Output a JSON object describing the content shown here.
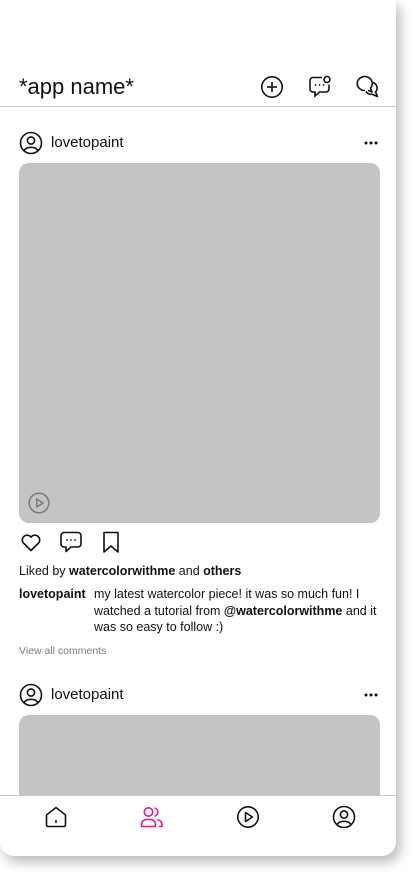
{
  "header": {
    "app_name": "*app name*",
    "icons": [
      "add-icon",
      "chat-notification-icon",
      "messages-icon"
    ]
  },
  "posts": [
    {
      "username": "lovetopaint",
      "media_type": "video",
      "liked_prefix": "Liked by ",
      "liked_user": "watercolorwithme",
      "liked_mid": " and ",
      "liked_suffix": "others",
      "caption_user": "lovetopaint",
      "caption_part1": "my latest watercolor piece! it was so much fun! I watched a tutorial from ",
      "caption_mention": "@watercolorwithme",
      "caption_part2": " and it was so easy to follow :)",
      "view_comments": "View all comments"
    },
    {
      "username": "lovetopaint"
    }
  ],
  "nav": {
    "items": [
      "home-icon",
      "friends-icon",
      "video-icon",
      "profile-icon"
    ],
    "active": "friends-icon"
  },
  "colors": {
    "accent": "#e6168c",
    "media_placeholder": "#c4c4c4",
    "divider": "#c8c8c8",
    "muted_text": "#7a7a7a"
  }
}
